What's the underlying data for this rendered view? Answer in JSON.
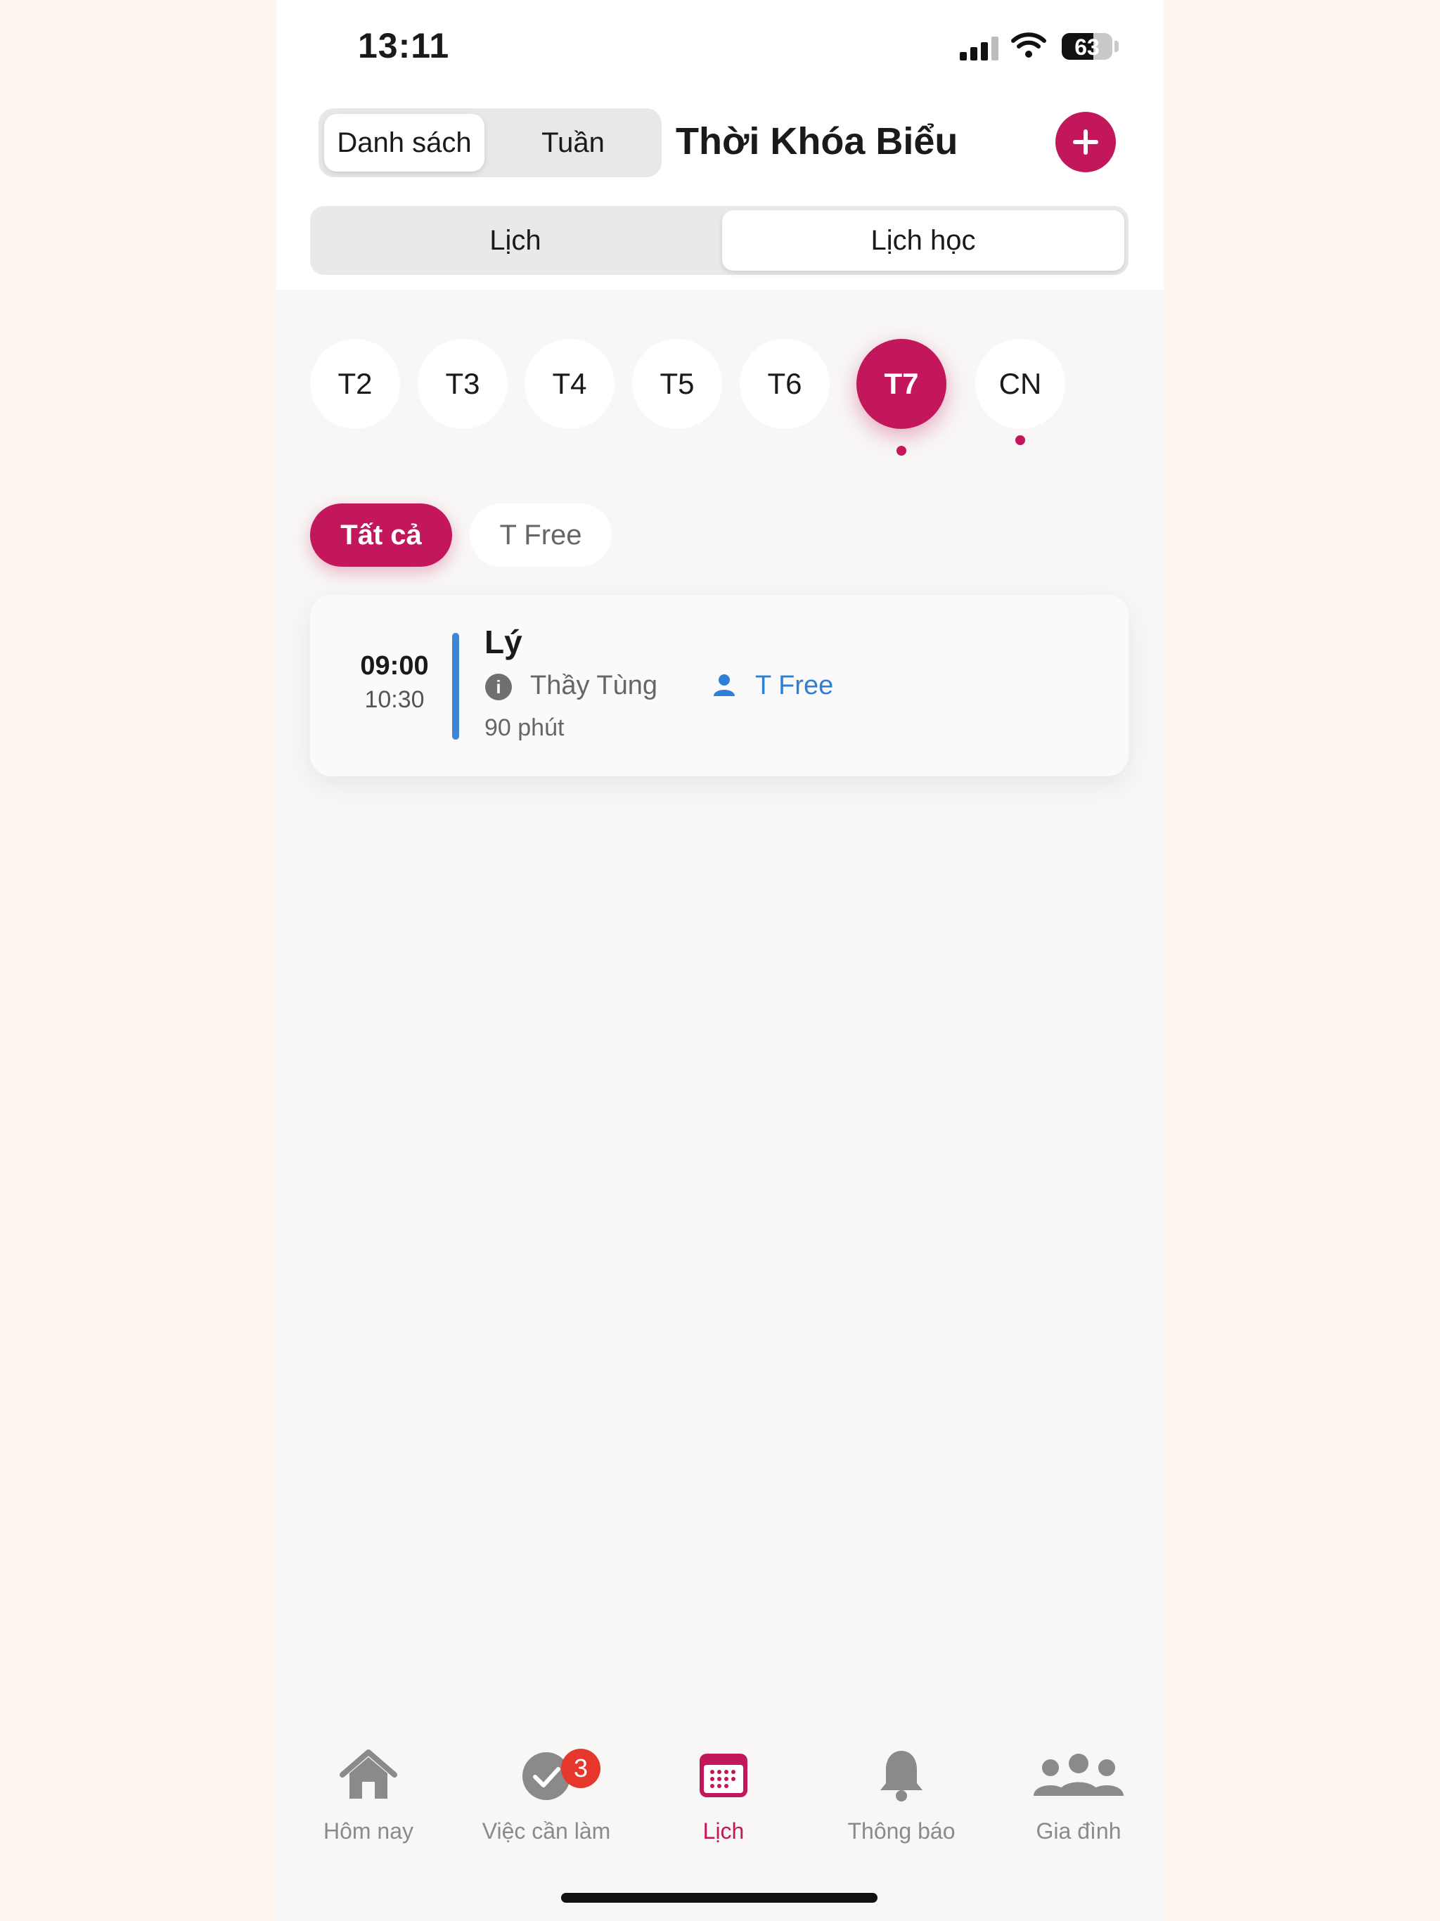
{
  "status_bar": {
    "time": "13:11",
    "battery": "63",
    "battery_level": 0.63
  },
  "header": {
    "view_toggle": [
      {
        "label": "Danh sách",
        "active": true
      },
      {
        "label": "Tuần",
        "active": false
      }
    ],
    "title": "Thời Khóa Biểu",
    "add_icon": "plus-icon"
  },
  "mode_tabs": [
    {
      "label": "Lịch",
      "active": false
    },
    {
      "label": "Lịch học",
      "active": true
    }
  ],
  "days": [
    {
      "label": "T2",
      "active": false,
      "has_events": false
    },
    {
      "label": "T3",
      "active": false,
      "has_events": false
    },
    {
      "label": "T4",
      "active": false,
      "has_events": false
    },
    {
      "label": "T5",
      "active": false,
      "has_events": false
    },
    {
      "label": "T6",
      "active": false,
      "has_events": false
    },
    {
      "label": "T7",
      "active": true,
      "has_events": true
    },
    {
      "label": "CN",
      "active": false,
      "has_events": true
    }
  ],
  "filters": [
    {
      "label": "Tất cả",
      "active": true
    },
    {
      "label": "T Free",
      "active": false
    }
  ],
  "classes": [
    {
      "start": "09:00",
      "end": "10:30",
      "subject": "Lý",
      "teacher": "Thầy Tùng",
      "student": "T Free",
      "duration": "90 phút",
      "bar_color": "#3D86D6"
    }
  ],
  "bottom_nav": [
    {
      "label": "Hôm nay",
      "icon": "home-icon",
      "active": false
    },
    {
      "label": "Việc cần làm",
      "icon": "check-circle-icon",
      "active": false,
      "badge": "3"
    },
    {
      "label": "Lịch",
      "icon": "calendar-icon",
      "active": true
    },
    {
      "label": "Thông báo",
      "icon": "bell-icon",
      "active": false
    },
    {
      "label": "Gia đình",
      "icon": "family-icon",
      "active": false
    }
  ],
  "colors": {
    "accent": "#C2185B",
    "link": "#2F7FD6",
    "badge": "#E5372B"
  }
}
